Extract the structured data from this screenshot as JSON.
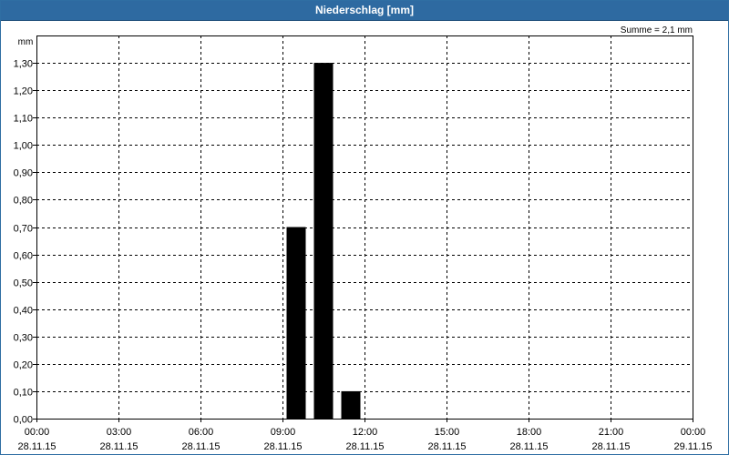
{
  "window": {
    "title": "Niederschlag [mm]"
  },
  "chart_data": {
    "type": "bar",
    "title": "Niederschlag [mm]",
    "ylabel": "mm",
    "ylim": [
      0,
      1.4
    ],
    "grid": true,
    "summary": "Summe = 2,1 mm",
    "x_range": [
      "28.11.15 00:00",
      "29.11.15 00:00"
    ],
    "y_ticks": [
      "0,00",
      "0,10",
      "0,20",
      "0,30",
      "0,40",
      "0,50",
      "0,60",
      "0,70",
      "0,80",
      "0,90",
      "1,00",
      "1,10",
      "1,20",
      "1,30"
    ],
    "x_ticks": [
      {
        "time": "00:00",
        "date": "28.11.15"
      },
      {
        "time": "03:00",
        "date": "28.11.15"
      },
      {
        "time": "06:00",
        "date": "28.11.15"
      },
      {
        "time": "09:00",
        "date": "28.11.15"
      },
      {
        "time": "12:00",
        "date": "28.11.15"
      },
      {
        "time": "15:00",
        "date": "28.11.15"
      },
      {
        "time": "18:00",
        "date": "28.11.15"
      },
      {
        "time": "21:00",
        "date": "28.11.15"
      },
      {
        "time": "00:00",
        "date": "29.11.15"
      }
    ],
    "bar_duration_hours": 1,
    "bars": [
      {
        "start": "28.11.15 09:00",
        "value": 0.7
      },
      {
        "start": "28.11.15 10:00",
        "value": 1.3
      },
      {
        "start": "28.11.15 11:00",
        "value": 0.1
      }
    ],
    "colors": {
      "bar": "#000000",
      "grid": "#000000",
      "title_bar": "#2e6aa1"
    }
  }
}
